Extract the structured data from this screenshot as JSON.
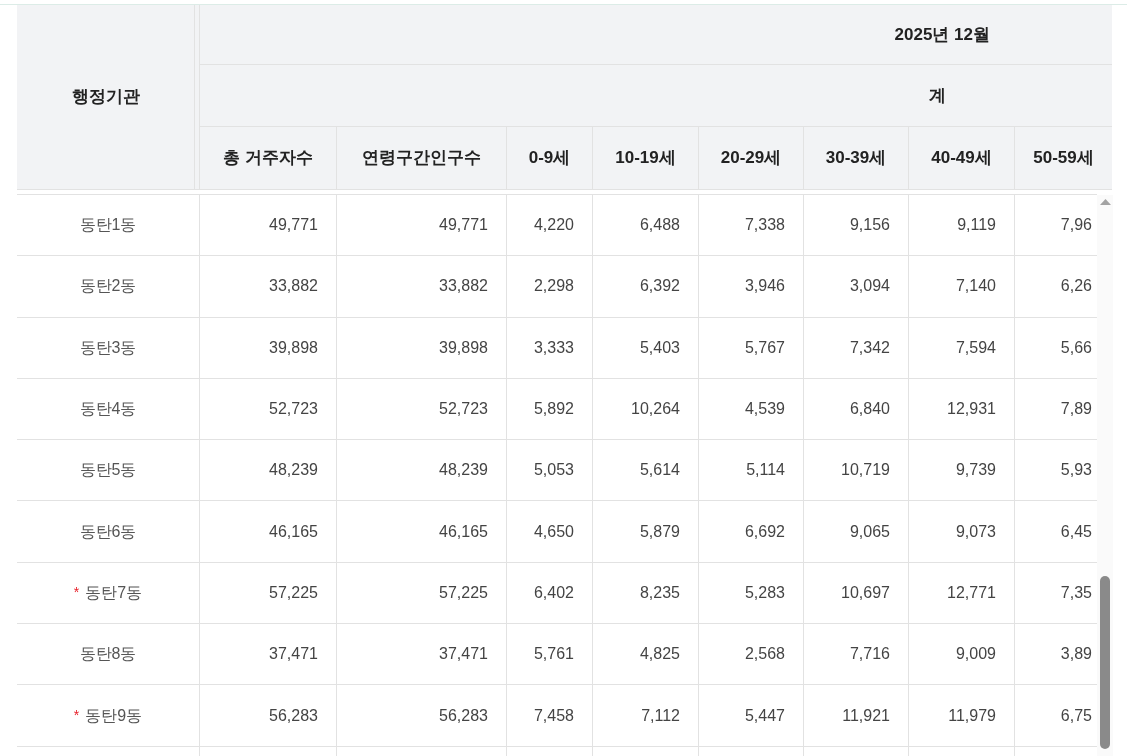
{
  "table": {
    "row_header": "행정기관",
    "period": "2025년 12월",
    "group": "계",
    "columns": [
      "총 거주자수",
      "연령구간인구수",
      "0-9세",
      "10-19세",
      "20-29세",
      "30-39세",
      "40-49세",
      "50-59세"
    ],
    "rows": [
      {
        "name": "동탄1동",
        "values": [
          "49,771",
          "49,771",
          "4,220",
          "6,488",
          "7,338",
          "9,156",
          "9,119",
          "7,96"
        ]
      },
      {
        "name": "동탄2동",
        "values": [
          "33,882",
          "33,882",
          "2,298",
          "6,392",
          "3,946",
          "3,094",
          "7,140",
          "6,26"
        ]
      },
      {
        "name": "동탄3동",
        "values": [
          "39,898",
          "39,898",
          "3,333",
          "5,403",
          "5,767",
          "7,342",
          "7,594",
          "5,66"
        ]
      },
      {
        "name": "동탄4동",
        "values": [
          "52,723",
          "52,723",
          "5,892",
          "10,264",
          "4,539",
          "6,840",
          "12,931",
          "7,89"
        ]
      },
      {
        "name": "동탄5동",
        "values": [
          "48,239",
          "48,239",
          "5,053",
          "5,614",
          "5,114",
          "10,719",
          "9,739",
          "5,93"
        ]
      },
      {
        "name": "동탄6동",
        "values": [
          "46,165",
          "46,165",
          "4,650",
          "5,879",
          "6,692",
          "9,065",
          "9,073",
          "6,45"
        ]
      },
      {
        "name": "동탄7동",
        "mark": "*",
        "values": [
          "57,225",
          "57,225",
          "6,402",
          "8,235",
          "5,283",
          "10,697",
          "12,771",
          "7,35"
        ]
      },
      {
        "name": "동탄8동",
        "values": [
          "37,471",
          "37,471",
          "5,761",
          "4,825",
          "2,568",
          "7,716",
          "9,009",
          "3,89"
        ]
      },
      {
        "name": "동탄9동",
        "mark": "*",
        "values": [
          "56,283",
          "56,283",
          "7,458",
          "7,112",
          "5,447",
          "11,921",
          "11,979",
          "6,75"
        ]
      }
    ]
  }
}
